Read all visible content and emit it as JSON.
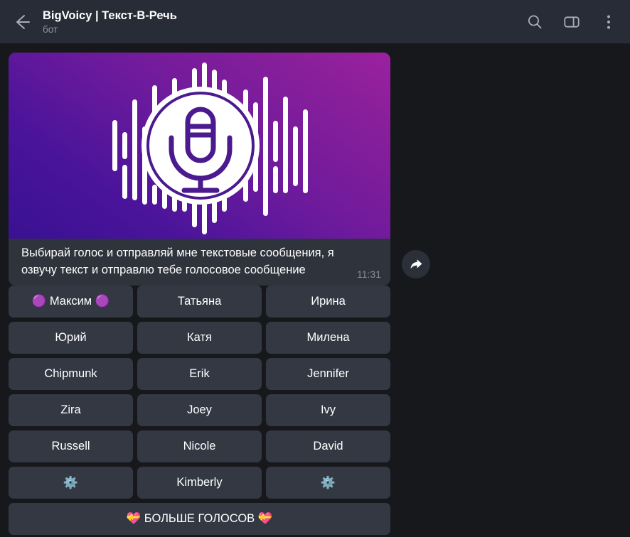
{
  "header": {
    "back_icon": "back-arrow-icon",
    "title": "BigVoicy | Текст-В-Речь",
    "subtitle": "бот",
    "actions": [
      {
        "name": "search-icon",
        "label": "Поиск"
      },
      {
        "name": "sidebar-toggle-icon",
        "label": "Панель"
      },
      {
        "name": "more-options-icon",
        "label": "Ещё"
      }
    ]
  },
  "message": {
    "photo_alt": "microphone-waveform-logo",
    "caption": "Выбирай голос и отправляй мне текстовые сообщения, я озвучу текст и отправлю тебе голосовое сообщение",
    "time": "11:31",
    "share_icon": "forward-arrow-icon"
  },
  "keyboard": {
    "rows": [
      [
        {
          "label": "🟣 Максим 🟣",
          "name": "voice-button-maksim"
        },
        {
          "label": "Татьяна",
          "name": "voice-button-tatyana"
        },
        {
          "label": "Ирина",
          "name": "voice-button-irina"
        }
      ],
      [
        {
          "label": "Юрий",
          "name": "voice-button-yuriy"
        },
        {
          "label": "Катя",
          "name": "voice-button-katya"
        },
        {
          "label": "Милена",
          "name": "voice-button-milena"
        }
      ],
      [
        {
          "label": "Chipmunk",
          "name": "voice-button-chipmunk"
        },
        {
          "label": "Erik",
          "name": "voice-button-erik"
        },
        {
          "label": "Jennifer",
          "name": "voice-button-jennifer"
        }
      ],
      [
        {
          "label": "Zira",
          "name": "voice-button-zira"
        },
        {
          "label": "Joey",
          "name": "voice-button-joey"
        },
        {
          "label": "Ivy",
          "name": "voice-button-ivy"
        }
      ],
      [
        {
          "label": "Russell",
          "name": "voice-button-russell"
        },
        {
          "label": "Nicole",
          "name": "voice-button-nicole"
        },
        {
          "label": "David",
          "name": "voice-button-david"
        }
      ],
      [
        {
          "label": "⚙️",
          "name": "settings-button-left"
        },
        {
          "label": "Kimberly",
          "name": "voice-button-kimberly"
        },
        {
          "label": "⚙️",
          "name": "settings-button-right"
        }
      ]
    ],
    "more_voices": {
      "label": "💝 БОЛЬШЕ ГОЛОСОВ 💝",
      "name": "more-voices-button"
    }
  },
  "colors": {
    "app_background": "#17181c",
    "header_background": "#282c37",
    "bubble_background": "#2f333c",
    "button_background": "#333843",
    "text_primary": "#ffffff",
    "text_secondary": "#8e949f",
    "gradient_from": "#9b21a0",
    "gradient_to": "#391191"
  }
}
